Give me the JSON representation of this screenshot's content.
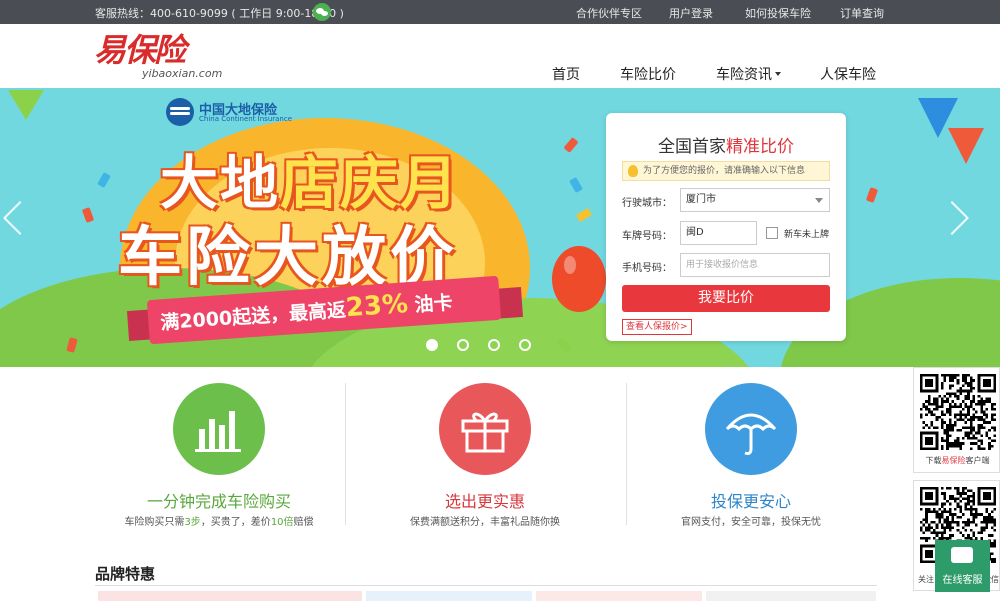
{
  "topbar": {
    "hotline": "客服热线：400-610-9099 ( 工作日 9:00-18:00 )",
    "links": [
      "合作伙伴专区",
      "用户登录",
      "如何投保车险",
      "订单查询"
    ]
  },
  "header": {
    "logo_cn": "易保险",
    "logo_en": "yibaoxian.com",
    "nav": [
      "首页",
      "车险比价",
      "车险资讯",
      "人保车险"
    ]
  },
  "banner": {
    "brand_cn": "中国大地保险",
    "brand_en": "China Continent Insurance",
    "head_a": "大地",
    "head_b": "店庆月",
    "head_line2": "车险大放价",
    "promo_a": "满2000起送，最高返",
    "promo_pct": "23%",
    "promo_b": "油卡",
    "slide_count": 4,
    "active_slide": 1
  },
  "quote": {
    "title_a": "全国首家",
    "title_b": "精准比价",
    "tip": "为了方便您的报价，请准确输入以下信息",
    "city_label": "行驶城市：",
    "city_value": "厦门市",
    "plate_label": "车牌号码：",
    "plate_value": "闽D",
    "new_car_label": "新车未上牌",
    "phone_label": "手机号码：",
    "phone_placeholder": "用于接收报价信息",
    "submit": "我要比价",
    "link": "查看人保报价>"
  },
  "features": [
    {
      "title": "一分钟完成车险购买",
      "desc_a": "车险购买只需",
      "desc_b": "3步",
      "desc_c": "，买贵了，差价",
      "desc_d": "10倍",
      "desc_e": "赔偿",
      "color": "#6cbf4b",
      "title_color": "#5aa83c"
    },
    {
      "title": "选出更实惠",
      "desc": "保费满额送积分，丰富礼品随你换",
      "color": "#e8575a",
      "title_color": "#d6393d"
    },
    {
      "title": "投保更安心",
      "desc": "官网支付，安全可靠，投保无忧",
      "color": "#3f9ce0",
      "title_color": "#2d86c9"
    }
  ],
  "brand_section": {
    "title": "品牌特惠"
  },
  "sidebar": {
    "download_a": "下载",
    "download_b": "易保险",
    "download_c": "客户端",
    "follow": "关注",
    "follow_right": "微信",
    "customer_service": "在线客服"
  },
  "colors": {
    "topbar": "#4a4d53",
    "accent_red": "#e8383d",
    "sky": "#72d8e0",
    "green_service": "#2e9b6b"
  }
}
